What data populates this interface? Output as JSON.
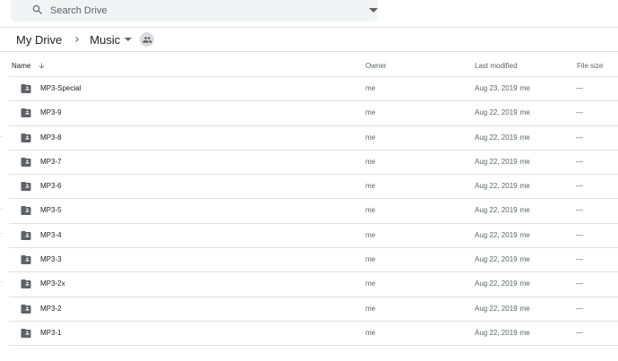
{
  "search": {
    "placeholder": "Search Drive",
    "value": ""
  },
  "breadcrumb": {
    "root": "My Drive",
    "current": "Music"
  },
  "columns": {
    "name": "Name",
    "owner": "Owner",
    "modified": "Last modified",
    "size": "File size"
  },
  "rows": [
    {
      "name": "MP3-Special",
      "owner": "me",
      "modified": "Aug 23, 2019",
      "modified_by": "me",
      "size": "—"
    },
    {
      "name": "MP3-9",
      "owner": "me",
      "modified": "Aug 22, 2019",
      "modified_by": "me",
      "size": "—"
    },
    {
      "name": "MP3-8",
      "owner": "me",
      "modified": "Aug 22, 2019",
      "modified_by": "me",
      "size": "—"
    },
    {
      "name": "MP3-7",
      "owner": "me",
      "modified": "Aug 22, 2019",
      "modified_by": "me",
      "size": "—"
    },
    {
      "name": "MP3-6",
      "owner": "me",
      "modified": "Aug 22, 2019",
      "modified_by": "me",
      "size": "—"
    },
    {
      "name": "MP3-5",
      "owner": "me",
      "modified": "Aug 22, 2019",
      "modified_by": "me",
      "size": "—"
    },
    {
      "name": "MP3-4",
      "owner": "me",
      "modified": "Aug 22, 2019",
      "modified_by": "me",
      "size": "—"
    },
    {
      "name": "MP3-3",
      "owner": "me",
      "modified": "Aug 22, 2019",
      "modified_by": "me",
      "size": "—"
    },
    {
      "name": "MP3-2x",
      "owner": "me",
      "modified": "Aug 22, 2019",
      "modified_by": "me",
      "size": "—"
    },
    {
      "name": "MP3-2",
      "owner": "me",
      "modified": "Aug 22, 2019",
      "modified_by": "me",
      "size": "—"
    },
    {
      "name": "MP3-1",
      "owner": "me",
      "modified": "Aug 22, 2019",
      "modified_by": "me",
      "size": "—"
    }
  ],
  "colors": {
    "icon": "#5f6368",
    "text": "#202124",
    "muted": "#5f6368",
    "divider": "#e0e0e0",
    "search_bg": "#f1f3f4"
  }
}
